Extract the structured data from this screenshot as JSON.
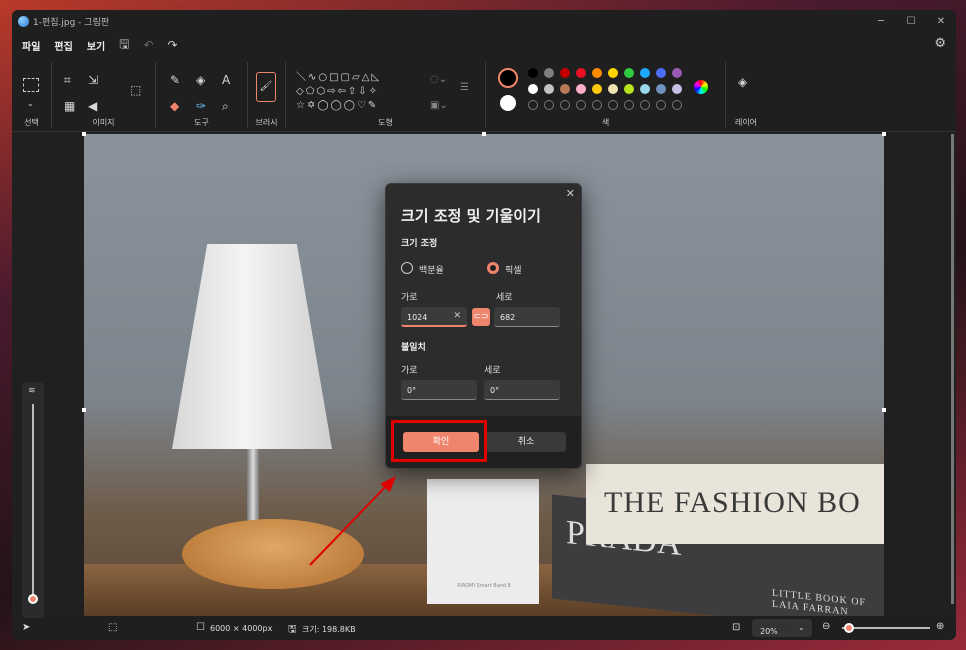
{
  "window": {
    "title": "1-편집.jpg - 그림판"
  },
  "menu": {
    "file": "파일",
    "edit": "편집",
    "view": "보기"
  },
  "ribbon": {
    "select": "선택",
    "image": "이미지",
    "tools": "도구",
    "brush": "브러시",
    "shapes": "도형",
    "color": "색",
    "layers": "레이어"
  },
  "palette": {
    "top": [
      "#000000",
      "#7f7f7f",
      "#c00000",
      "#e81123",
      "#ff8c00",
      "#ffd400",
      "#2ecc40",
      "#1ea7ff",
      "#4a6cf7",
      "#9b59b6"
    ],
    "bottom": [
      "#ffffff",
      "#c3c3c3",
      "#b97a57",
      "#ffaec9",
      "#ffc90e",
      "#efe4b0",
      "#b5e61d",
      "#99d9ea",
      "#7092be",
      "#c8bfe7"
    ],
    "primary": "#000000",
    "secondary": "#ffffff"
  },
  "photo": {
    "book1_text": "THE FASHION BO",
    "book2_text": "PRADA",
    "book2_sub": "LITTLE BOOK OF\nLAIA FARRAN",
    "box_text": "XIAOMI Smart Band 8"
  },
  "dialog": {
    "title": "크기 조정 및 기울이기",
    "resize_section": "크기 조정",
    "percent_option": "백분율",
    "pixel_option": "픽셀",
    "width_label": "가로",
    "height_label": "세로",
    "width_value": "1024",
    "height_value": "682",
    "skew_section": "불일치",
    "skew_h_label": "가로",
    "skew_v_label": "세로",
    "skew_h_value": "0°",
    "skew_v_value": "0°",
    "ok": "확인",
    "cancel": "취소"
  },
  "status": {
    "dimensions": "6000 × 4000px",
    "size": "크기: 198.8KB",
    "zoom": "20%"
  },
  "accent": "#f0856d"
}
